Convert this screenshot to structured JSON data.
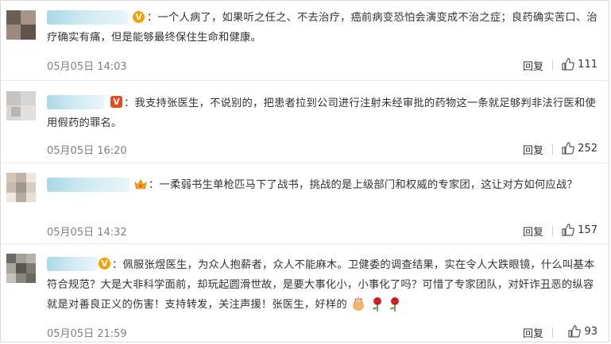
{
  "comments": [
    {
      "text": "：一个人病了，如果听之任之、不去治疗，癌前病变恐怕会演变成不治之症；良药确实苦口、治疗确实有痛，但是能够最终保住生命和健康。",
      "time": "05月05日 14:03",
      "reply_label": "回复",
      "likes": "111",
      "badge": "gold-v-icon"
    },
    {
      "text": "：我支持张医生，不说别的，把患者拉到公司进行注射未经审批的药物这一条就足够判非法行医和使用假药的罪名。",
      "time": "05月05日 16:20",
      "reply_label": "回复",
      "likes": "252",
      "badge": "red-v-icon"
    },
    {
      "text": "：一柔弱书生单枪匹马下了战书，挑战的是上级部门和权威的专家团，这让对方如何应战？",
      "time": "05月05日 14:32",
      "reply_label": "回复",
      "likes": "157",
      "badge": "crown-icon"
    },
    {
      "text": "：佩服张煜医生，为众人抱薪者，众人不能麻木。卫健委的调查结果，实在令人大跌眼镜，什么叫基本符合规范？大是大非科学面前，却玩起圆滑世故，是要大事化小，小事化了吗？可惜了专家团队，对奸诈丑恶的纵容就是对善良正义的伤害！支持转发，关注声援！张医生，好样的",
      "time": "05月05日 21:59",
      "reply_label": "回复",
      "likes": "93",
      "badge": "gold-v-icon"
    }
  ],
  "colors": {
    "text": "#333333",
    "time": "#808080",
    "gold_badge": "#f2a100",
    "red_badge": "#e84b1a"
  }
}
